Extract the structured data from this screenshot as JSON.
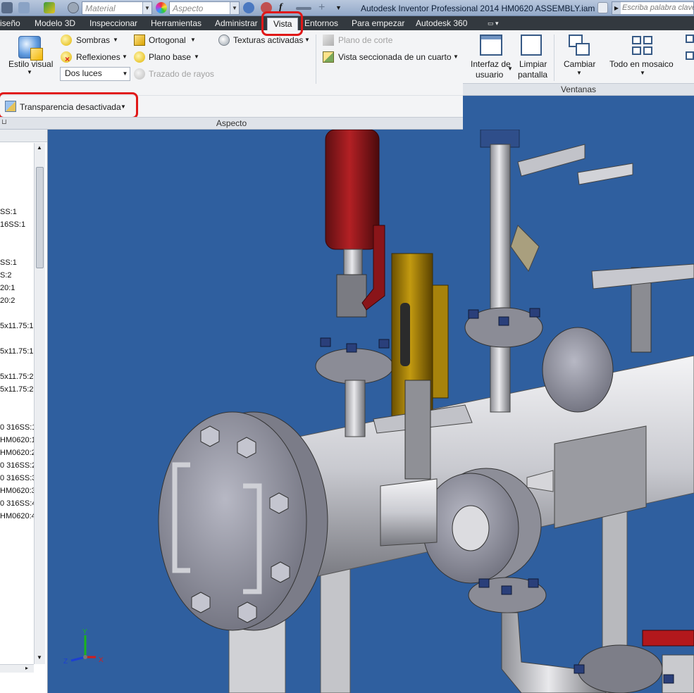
{
  "quick_access": {
    "material_combo": "Material",
    "aspect_combo": "Aspecto"
  },
  "window": {
    "title": "Autodesk Inventor Professional 2014    HM0620 ASSEMBLY.iam",
    "help_search_placeholder": "Escriba palabra clave"
  },
  "menu_tabs": [
    {
      "label": "iseño"
    },
    {
      "label": "Modelo 3D"
    },
    {
      "label": "Inspeccionar"
    },
    {
      "label": "Herramientas"
    },
    {
      "label": "Administrar"
    },
    {
      "label": "Vista",
      "active": true
    },
    {
      "label": "Entornos"
    },
    {
      "label": "Para empezar"
    },
    {
      "label": "Autodesk 360"
    }
  ],
  "ribbon": {
    "aspecto": {
      "estilo_visual": "Estilo visual",
      "sombras": "Sombras",
      "reflexiones": "Reflexiones",
      "iluminacion": "Dos luces",
      "ortogonal": "Ortogonal",
      "plano_base": "Plano base",
      "trazado_rayos": "Trazado de rayos",
      "texturas": "Texturas activadas",
      "plano_corte": "Plano de corte",
      "vista_seccionada": "Vista seccionada de un cuarto",
      "transparencia": "Transparencia desactivada",
      "panel_label": "Aspecto"
    },
    "ventanas": {
      "interfaz_line1": "Interfaz de",
      "interfaz_line2": "usuario",
      "limpiar_line1": "Limpiar",
      "limpiar_line2": "pantalla",
      "cambiar": "Cambiar",
      "mosaico": "Todo en mosaico",
      "panel_label": "Ventanas"
    }
  },
  "browser_items": [
    "SS:1",
    "16SS:1",
    "SS:1",
    "S:2",
    "20:1",
    "20:2",
    "5x11.75:1",
    "5x11.75:1",
    "5x11.75:2",
    "5x11.75:2",
    "0 316SS:1",
    "HM0620:1",
    "HM0620:2",
    "0 316SS:2",
    "0 316SS:3",
    "HM0620:3",
    "0 316SS:4",
    "HM0620:4"
  ],
  "triad": {
    "x": "X",
    "y": "Y",
    "z": "Z"
  },
  "colors": {
    "viewport_bg": "#2f5f9f",
    "highlight_ring": "#e01818",
    "menubar_bg": "#33393f"
  }
}
